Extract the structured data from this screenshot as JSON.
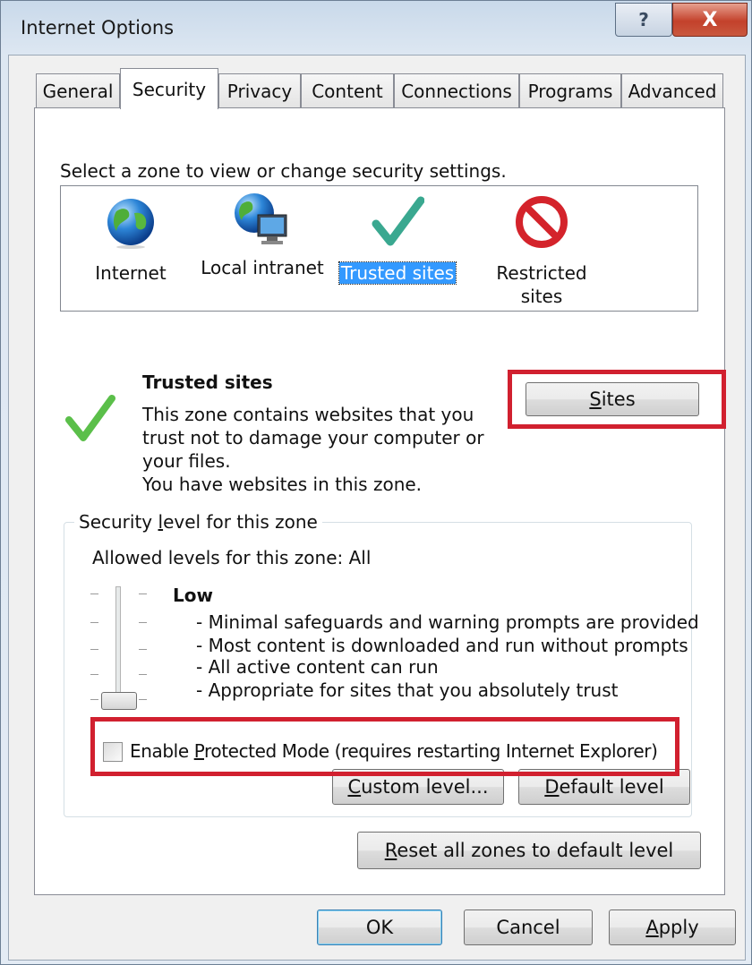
{
  "window": {
    "title": "Internet Options",
    "help_glyph": "?",
    "close_glyph": "X"
  },
  "tabs": [
    {
      "label": "General"
    },
    {
      "label": "Security"
    },
    {
      "label": "Privacy"
    },
    {
      "label": "Content"
    },
    {
      "label": "Connections"
    },
    {
      "label": "Programs"
    },
    {
      "label": "Advanced"
    }
  ],
  "active_tab": "Security",
  "security": {
    "instruction": "Select a zone to view or change security settings.",
    "zones": [
      {
        "label": "Internet",
        "icon": "globe-icon"
      },
      {
        "label": "Local intranet",
        "icon": "intranet-globe-icon"
      },
      {
        "label": "Trusted sites",
        "icon": "checkmark-icon",
        "selected": true
      },
      {
        "label_line1": "Restricted",
        "label_line2": "sites",
        "icon": "no-entry-icon"
      }
    ],
    "zone_info": {
      "title": "Trusted sites",
      "description_lines": [
        "This zone contains websites that you",
        "trust not to damage your computer or",
        "your files.",
        "You have websites in this zone."
      ]
    },
    "sites_button": {
      "pre": "",
      "accel": "S",
      "post": "ites"
    },
    "level_group": {
      "legend_pre": "Security ",
      "legend_accel": "l",
      "legend_post": "evel for this zone",
      "allowed": "Allowed levels for this zone: All",
      "level_name": "Low",
      "level_points": [
        "- Minimal safeguards and warning prompts are provided",
        "- Most content is downloaded and run without prompts",
        "- All active content can run",
        "- Appropriate for sites that you absolutely trust"
      ],
      "slider_level": "Low",
      "protected_mode": {
        "checked": false,
        "pre": "Enable ",
        "accel": "P",
        "post": "rotected Mode (requires restarting Internet Explorer)"
      },
      "custom_button": {
        "accel": "C",
        "post": "ustom level..."
      },
      "default_button": {
        "accel": "D",
        "post": "efault level"
      }
    },
    "reset_button": {
      "accel": "R",
      "post": "eset all zones to default level"
    }
  },
  "footer": {
    "ok": "OK",
    "cancel": "Cancel",
    "apply": {
      "accel": "A",
      "post": "pply"
    }
  },
  "colors": {
    "highlight": "#d1202f",
    "selection": "#3399ff",
    "check_green": "#5bbf4a"
  }
}
